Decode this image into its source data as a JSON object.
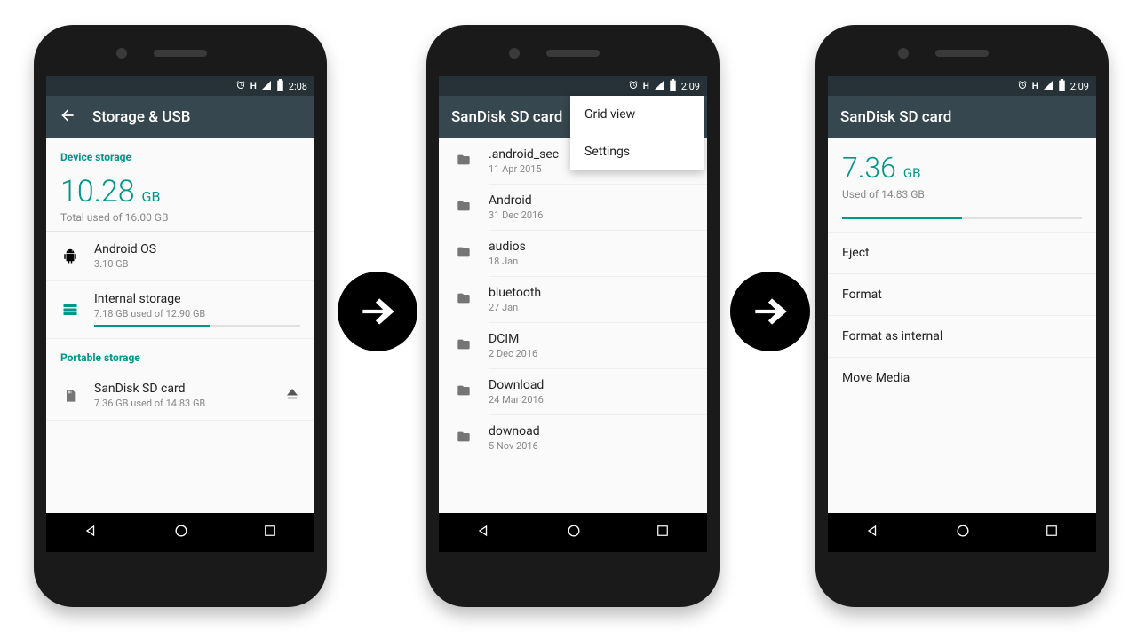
{
  "statusbar": {
    "h_letter": "H",
    "time_p1": "2:08",
    "time_p2": "2:09",
    "time_p3": "2:09"
  },
  "phone1": {
    "appbar_title": "Storage & USB",
    "section_device": "Device storage",
    "used_value": "10.28",
    "used_unit": "GB",
    "used_sub": "Total used of 16.00 GB",
    "row_os_title": "Android OS",
    "row_os_sub": "3.10 GB",
    "row_internal_title": "Internal storage",
    "row_internal_sub": "7.18 GB used of 12.90 GB",
    "internal_fill_pct": 56,
    "section_portable": "Portable storage",
    "row_sd_title": "SanDisk SD card",
    "row_sd_sub": "7.36 GB used of 14.83 GB"
  },
  "phone2": {
    "appbar_title": "SanDisk SD card",
    "popup_item1": "Grid view",
    "popup_item2": "Settings",
    "folders": [
      {
        "name": ".android_sec",
        "date": "11 Apr 2015"
      },
      {
        "name": "Android",
        "date": "31 Dec 2016"
      },
      {
        "name": "audios",
        "date": "18 Jan"
      },
      {
        "name": "bluetooth",
        "date": "27 Jan"
      },
      {
        "name": "DCIM",
        "date": "2 Dec 2016"
      },
      {
        "name": "Download",
        "date": "24 Mar 2016"
      },
      {
        "name": "downoad",
        "date": "5 Nov 2016"
      }
    ]
  },
  "phone3": {
    "appbar_title": "SanDisk SD card",
    "used_value": "7.36",
    "used_unit": "GB",
    "used_sub": "Used of 14.83 GB",
    "fill_pct": 50,
    "opt1": "Eject",
    "opt2": "Format",
    "opt3": "Format as internal",
    "opt4": "Move Media"
  }
}
